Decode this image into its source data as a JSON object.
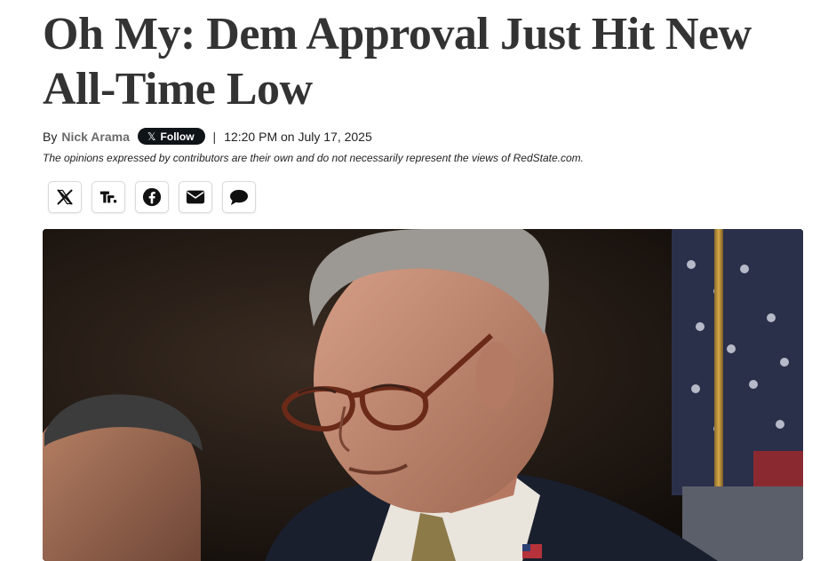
{
  "article": {
    "title": "Oh My: Dem Approval Just Hit New All-Time Low",
    "byline": {
      "prefix": "By",
      "author": "Nick Arama",
      "follow_label": "Follow",
      "follow_icon": "x-logo-icon",
      "separator": "|",
      "timestamp": "12:20 PM on July 17, 2025"
    },
    "disclaimer": "The opinions expressed by contributors are their own and do not necessarily represent the views of RedState.com."
  },
  "share": {
    "buttons": [
      {
        "icon": "x-logo-icon"
      },
      {
        "icon": "truth-social-icon"
      },
      {
        "icon": "facebook-icon"
      },
      {
        "icon": "email-icon"
      },
      {
        "icon": "comment-icon"
      }
    ]
  },
  "colors": {
    "headline": "#333333",
    "author": "#6b6b6b",
    "follow_bg": "#0f1419",
    "button_border": "#d9d9d9"
  }
}
